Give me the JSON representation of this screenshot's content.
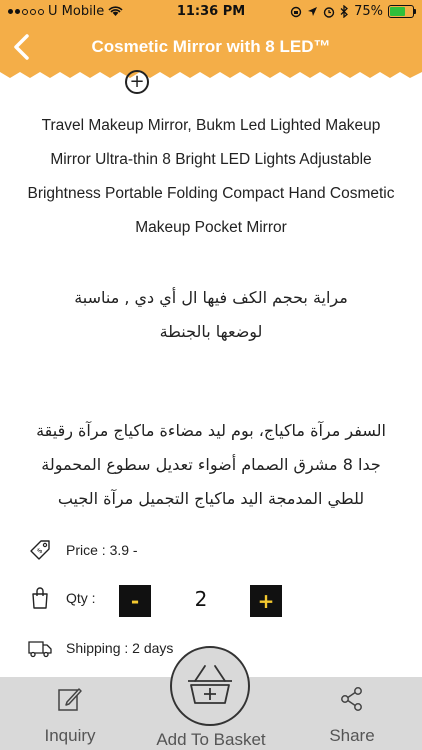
{
  "status_bar": {
    "carrier": "U Mobile",
    "time": "11:36 PM",
    "battery_percent": "75%",
    "battery_level": 0.75,
    "signal_bars_filled": 2,
    "colors": {
      "background": "#f4ae48",
      "battery": "#2fbf3b"
    }
  },
  "nav": {
    "title": "Cosmetic Mirror with 8 LED™",
    "back_icon": "chevron-left-icon",
    "color": "#f4ae48"
  },
  "description": {
    "english_lines": [
      "Travel Makeup Mirror, Bukm Led Lighted Makeup",
      "Mirror Ultra-thin 8 Bright LED Lights Adjustable",
      "Brightness Portable Folding Compact Hand Cosmetic",
      "Makeup Pocket Mirror"
    ],
    "arabic_block1": [
      "مراية بحجم الكف فيها ال أي دي , مناسبة",
      "لوضعها بالجنطة"
    ],
    "arabic_block2": [
      "السفر مرآة ماكياج، بوم ليد مضاءة ماكياج مرآة رقيقة",
      "جدا 8 مشرق الصمام أضواء تعديل سطوع المحمولة",
      "للطي المدمجة اليد ماكياج التجميل مرآة الجيب"
    ]
  },
  "details": {
    "price_label": "Price : 3.9 -",
    "qty_label": "Qty :",
    "qty_minus": "-",
    "qty_value": "2",
    "qty_plus": "+",
    "shipping_label": "Shipping : 2 days"
  },
  "bottom_bar": {
    "inquiry": "Inquiry",
    "add_to_basket": "Add To Basket",
    "share": "Share"
  }
}
